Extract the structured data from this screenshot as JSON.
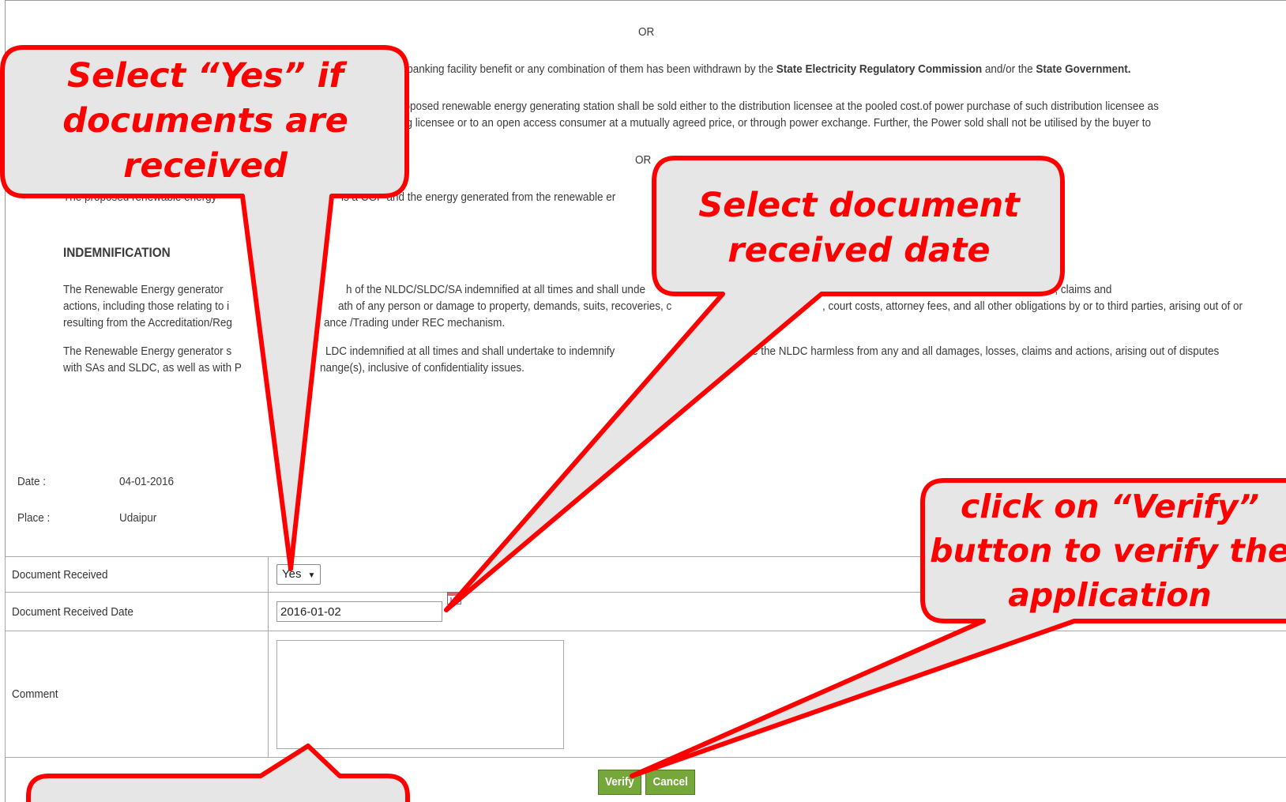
{
  "declaration": {
    "or_1": "OR",
    "line_1_end": "r banking facility benefit or any combination of them has been withdrawn by the",
    "line_1_b1": "State Electricity Regulatory Commission",
    "line_1_mid": "and/or the",
    "line_1_b2": "State Government.",
    "line_2": "roposed renewable energy generating station shall be sold either to the distribution licensee at the pooled cost.of power purchase of such distribution licensee as",
    "line_3": "ng licensee or to an open access consumer at a mutually agreed price, or through power exchange. Further, the Power sold shall not be utilised by the buyer to",
    "or_2": "OR",
    "line_4a": "The proposed renewable energy",
    "line_4b": "is a CGP and the energy generated from the renewable er",
    "indemnification_heading": "INDEMNIFICATION",
    "ind_1a": "The Renewable Energy generator",
    "ind_1b": "h of the NLDC/SLDC/SA indemnified at all times and shall unde",
    "ind_1c": "rom any and all damages, losses, claims and",
    "ind_2a": "actions, including those relating to i",
    "ind_2b": "ath of any person or damage to property, demands, suits, recoveries, c",
    "ind_2c": ", court costs, attorney fees, and all other obligations by or to third parties, arising out of or",
    "ind_3a": "resulting from the Accreditation/Reg",
    "ind_3b": "ance /Trading under REC mechanism.",
    "ind_4a": "The Renewable Energy generator s",
    "ind_4b": "LDC indemnified at all times and shall undertake to indemnify",
    "ind_4c": "e the NLDC harmless from any and all damages, losses, claims and actions, arising out of disputes",
    "ind_5a": "with SAs and SLDC, as well as with P",
    "ind_5b": "nange(s), inclusive of confidentiality issues."
  },
  "meta": {
    "date_label": "Date :",
    "date_value": "04-01-2016",
    "place_label": "Place :",
    "place_value": "Udaipur"
  },
  "form": {
    "doc_received_label": "Document Received",
    "doc_received_value": "Yes",
    "doc_received_date_label": "Document Received Date",
    "doc_received_date_value": "2016-01-02",
    "comment_label": "Comment",
    "comment_value": ""
  },
  "buttons": {
    "verify": "Verify",
    "cancel": "Cancel"
  },
  "callouts": {
    "select_yes": [
      "Select “Yes” if",
      "documents are",
      "received"
    ],
    "select_date": [
      "Select document",
      "received date"
    ],
    "verify": [
      "click on “Verify”",
      "button to verify the",
      "application"
    ]
  },
  "colors": {
    "callout_text": "#ff0000",
    "callout_border": "#ff0000",
    "callout_fill": "#e6e6e6",
    "button_green": "#76a73b"
  }
}
